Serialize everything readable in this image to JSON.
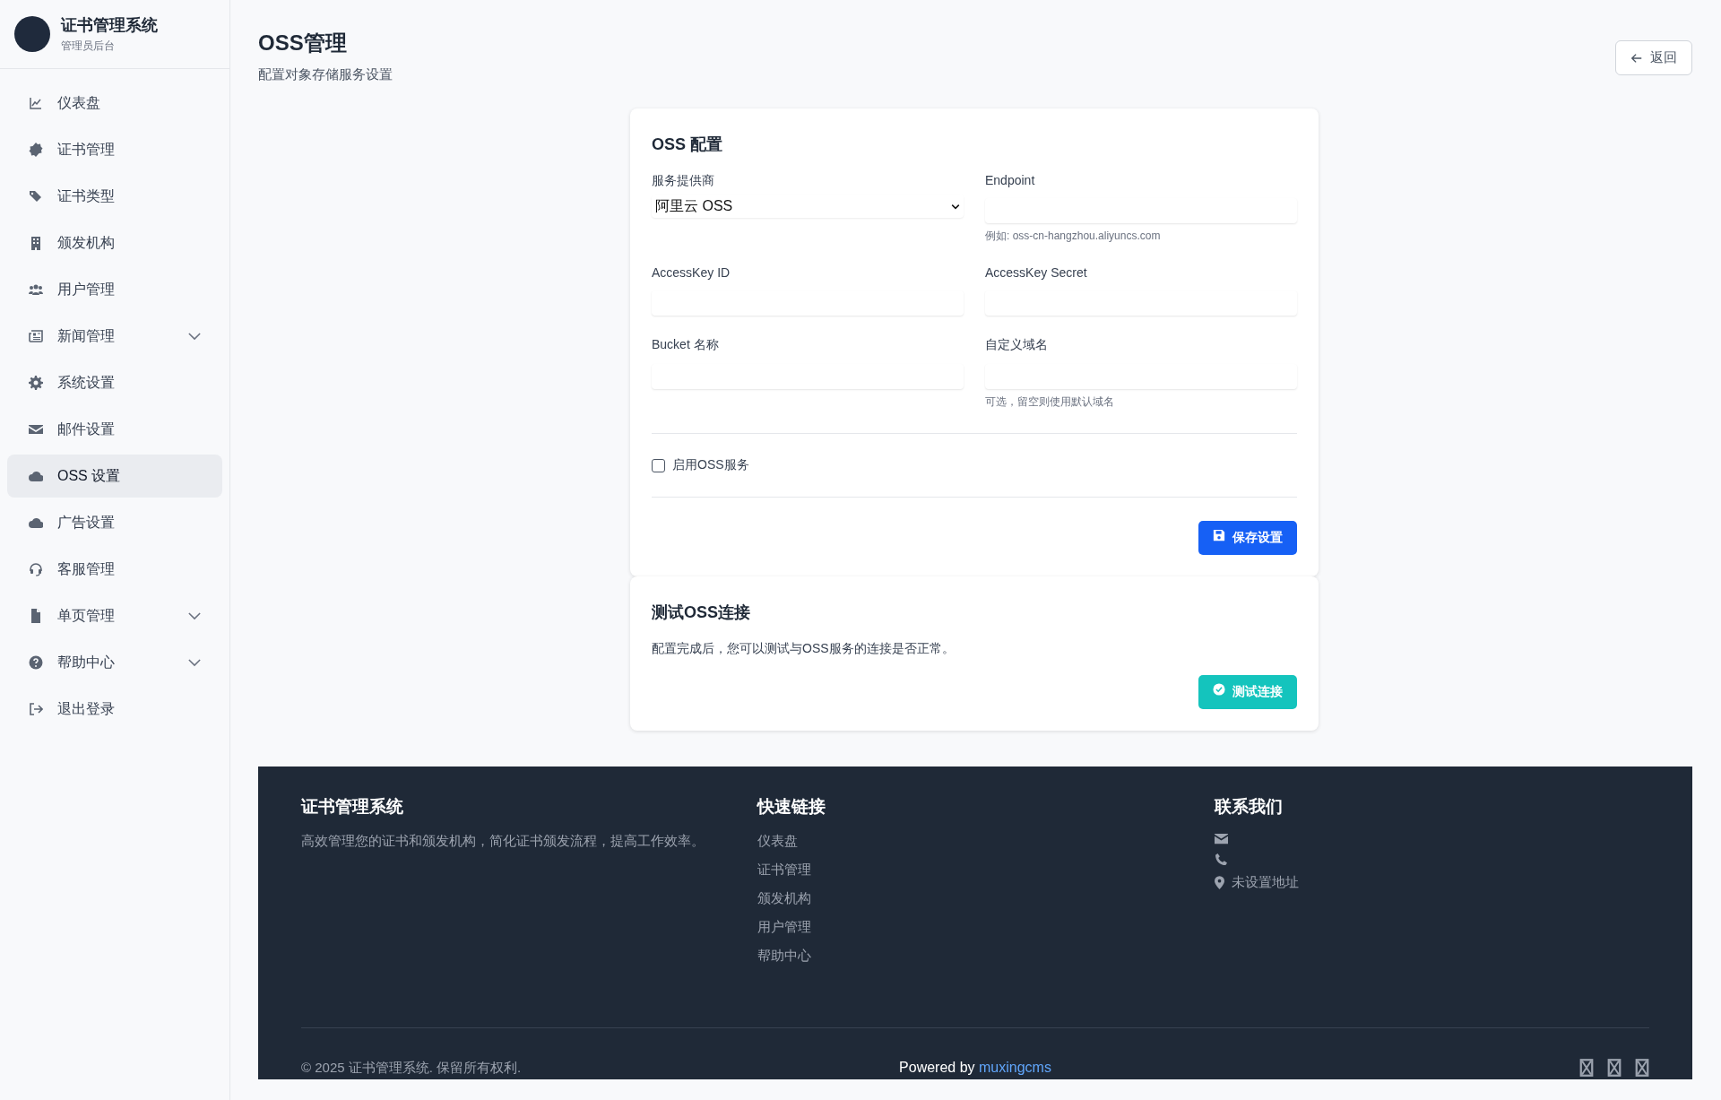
{
  "sidebar": {
    "brand": {
      "title": "证书管理系统",
      "subtitle": "管理员后台"
    },
    "items": [
      {
        "label": "仪表盘",
        "selected": false,
        "expandable": false
      },
      {
        "label": "证书管理",
        "selected": false,
        "expandable": false
      },
      {
        "label": "证书类型",
        "selected": false,
        "expandable": false
      },
      {
        "label": "颁发机构",
        "selected": false,
        "expandable": false
      },
      {
        "label": "用户管理",
        "selected": false,
        "expandable": false
      },
      {
        "label": "新闻管理",
        "selected": false,
        "expandable": true
      },
      {
        "label": "系统设置",
        "selected": false,
        "expandable": false
      },
      {
        "label": "邮件设置",
        "selected": false,
        "expandable": false
      },
      {
        "label": "OSS 设置",
        "selected": true,
        "expandable": false
      },
      {
        "label": "广告设置",
        "selected": false,
        "expandable": false
      },
      {
        "label": "客服管理",
        "selected": false,
        "expandable": false
      },
      {
        "label": "单页管理",
        "selected": false,
        "expandable": true
      },
      {
        "label": "帮助中心",
        "selected": false,
        "expandable": true
      },
      {
        "label": "退出登录",
        "selected": false,
        "expandable": false
      }
    ]
  },
  "page": {
    "title": "OSS管理",
    "subtitle": "配置对象存储服务设置",
    "back_button": "返回"
  },
  "config_card": {
    "title": "OSS 配置",
    "fields": [
      {
        "kind": "select",
        "label": "服务提供商",
        "value": "阿里云 OSS"
      },
      {
        "kind": "text",
        "label": "Endpoint",
        "help": "例如: oss-cn-hangzhou.aliyuncs.com"
      },
      {
        "kind": "text",
        "label": "AccessKey ID"
      },
      {
        "kind": "text",
        "label": "AccessKey Secret"
      },
      {
        "kind": "text",
        "label": "Bucket 名称"
      },
      {
        "kind": "text",
        "label": "自定义域名",
        "help": "可选，留空则使用默认域名"
      }
    ],
    "enable_checkbox": {
      "label": "启用OSS服务",
      "checked": false
    },
    "save_button": "保存设置"
  },
  "test_card": {
    "title": "测试OSS连接",
    "description": "配置完成后，您可以测试与OSS服务的连接是否正常。",
    "test_button": "测试连接"
  },
  "footer": {
    "about": {
      "title": "证书管理系统",
      "text": "高效管理您的证书和颁发机构，简化证书颁发流程，提高工作效率。"
    },
    "links": {
      "title": "快速链接",
      "items": [
        "仪表盘",
        "证书管理",
        "颁发机构",
        "用户管理",
        "帮助中心"
      ]
    },
    "contact": {
      "title": "联系我们",
      "address": "未设置地址"
    },
    "copyright": "© 2025 证书管理系统. 保留所有权利.",
    "powered_by": {
      "text": "Powered by",
      "link": "muxingcms"
    }
  }
}
